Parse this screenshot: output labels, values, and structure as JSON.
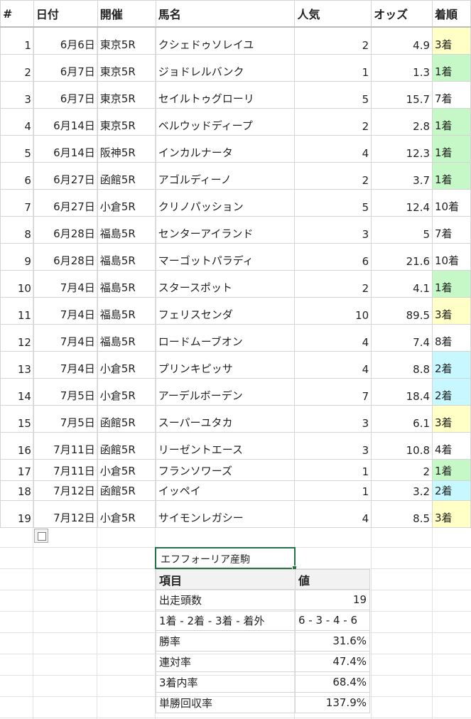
{
  "headers": [
    "#",
    "日付",
    "開催",
    "馬名",
    "人気",
    "オッズ",
    "着順"
  ],
  "rows": [
    {
      "no": "1",
      "date": "6月6日",
      "venue": "東京5R",
      "horse": "クシェドゥソレイユ",
      "pop": "2",
      "odds": "4.9",
      "finish": "3着",
      "hl": "y"
    },
    {
      "no": "2",
      "date": "6月7日",
      "venue": "東京5R",
      "horse": "ジョドレルバンク",
      "pop": "1",
      "odds": "1.3",
      "finish": "1着",
      "hl": "g"
    },
    {
      "no": "3",
      "date": "6月7日",
      "venue": "東京5R",
      "horse": "セイルトゥグローリ",
      "pop": "5",
      "odds": "15.7",
      "finish": "7着",
      "hl": ""
    },
    {
      "no": "4",
      "date": "6月14日",
      "venue": "東京5R",
      "horse": "ベルウッドディープ",
      "pop": "2",
      "odds": "2.8",
      "finish": "1着",
      "hl": "g"
    },
    {
      "no": "5",
      "date": "6月14日",
      "venue": "阪神5R",
      "horse": "インカルナータ",
      "pop": "4",
      "odds": "12.3",
      "finish": "1着",
      "hl": "g"
    },
    {
      "no": "6",
      "date": "6月27日",
      "venue": "函館5R",
      "horse": "アゴルディーノ",
      "pop": "2",
      "odds": "3.7",
      "finish": "1着",
      "hl": "g"
    },
    {
      "no": "7",
      "date": "6月27日",
      "venue": "小倉5R",
      "horse": "クリノパッション",
      "pop": "5",
      "odds": "12.4",
      "finish": "10着",
      "hl": ""
    },
    {
      "no": "8",
      "date": "6月28日",
      "venue": "福島5R",
      "horse": "センターアイランド",
      "pop": "3",
      "odds": "5",
      "finish": "7着",
      "hl": ""
    },
    {
      "no": "9",
      "date": "6月28日",
      "venue": "福島5R",
      "horse": "マーゴットパラディ",
      "pop": "6",
      "odds": "21.6",
      "finish": "10着",
      "hl": ""
    },
    {
      "no": "10",
      "date": "7月4日",
      "venue": "福島5R",
      "horse": "スタースポット",
      "pop": "2",
      "odds": "4.1",
      "finish": "1着",
      "hl": "g"
    },
    {
      "no": "11",
      "date": "7月4日",
      "venue": "福島5R",
      "horse": "フェリスセンダ",
      "pop": "10",
      "odds": "89.5",
      "finish": "3着",
      "hl": "y"
    },
    {
      "no": "12",
      "date": "7月4日",
      "venue": "福島5R",
      "horse": "ロードムーブオン",
      "pop": "4",
      "odds": "7.4",
      "finish": "8着",
      "hl": ""
    },
    {
      "no": "13",
      "date": "7月4日",
      "venue": "小倉5R",
      "horse": "プリンキピッサ",
      "pop": "4",
      "odds": "8.8",
      "finish": "2着",
      "hl": "c"
    },
    {
      "no": "14",
      "date": "7月5日",
      "venue": "小倉5R",
      "horse": "アーデルボーデン",
      "pop": "7",
      "odds": "18.4",
      "finish": "2着",
      "hl": "c"
    },
    {
      "no": "15",
      "date": "7月5日",
      "venue": "函館5R",
      "horse": "スーパーユタカ",
      "pop": "3",
      "odds": "6.1",
      "finish": "3着",
      "hl": "y"
    },
    {
      "no": "16",
      "date": "7月11日",
      "venue": "函館5R",
      "horse": "リーゼントエース",
      "pop": "3",
      "odds": "10.8",
      "finish": "4着",
      "hl": ""
    },
    {
      "no": "17",
      "date": "7月11日",
      "venue": "小倉5R",
      "horse": "フランソワーズ",
      "pop": "1",
      "odds": "2",
      "finish": "1着",
      "hl": "g"
    },
    {
      "no": "18",
      "date": "7月12日",
      "venue": "函館5R",
      "horse": "イッペイ",
      "pop": "1",
      "odds": "3.2",
      "finish": "2着",
      "hl": "c"
    },
    {
      "no": "19",
      "date": "7月12日",
      "venue": "小倉5R",
      "horse": "サイモンレガシー",
      "pop": "4",
      "odds": "8.5",
      "finish": "3着",
      "hl": "y"
    }
  ],
  "selected_cell": "エフフォーリア産駒",
  "stats": {
    "header_key": "項目",
    "header_value": "値",
    "items": [
      {
        "key": "出走頭数",
        "value": "19",
        "align": "r"
      },
      {
        "key": "1着 - 2着 - 3着 - 着外",
        "value": "6 - 3 - 4 - 6",
        "align": "l"
      },
      {
        "key": "勝率",
        "value": "31.6%",
        "align": "r"
      },
      {
        "key": "連対率",
        "value": "47.4%",
        "align": "r"
      },
      {
        "key": "3着内率",
        "value": "68.4%",
        "align": "r"
      },
      {
        "key": "単勝回収率",
        "value": "137.9%",
        "align": "r"
      }
    ]
  },
  "highlight_colors": {
    "y": "#ffffc6",
    "g": "#c6f7c6",
    "c": "#c8f8ff"
  }
}
